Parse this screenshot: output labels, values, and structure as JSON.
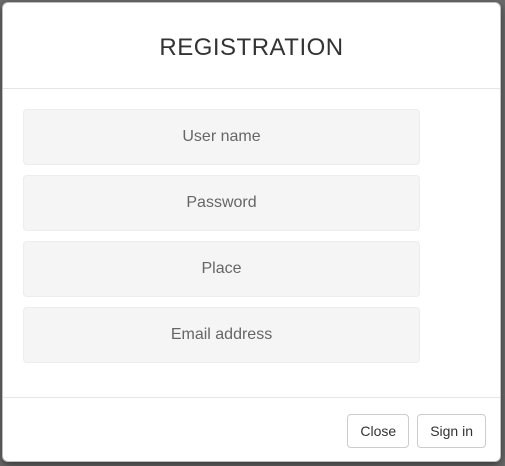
{
  "modal": {
    "title": "REGISTRATION"
  },
  "form": {
    "fields": [
      {
        "placeholder": "User name",
        "value": ""
      },
      {
        "placeholder": "Password",
        "value": ""
      },
      {
        "placeholder": "Place",
        "value": ""
      },
      {
        "placeholder": "Email address",
        "value": ""
      }
    ]
  },
  "footer": {
    "close_label": "Close",
    "signin_label": "Sign in"
  }
}
